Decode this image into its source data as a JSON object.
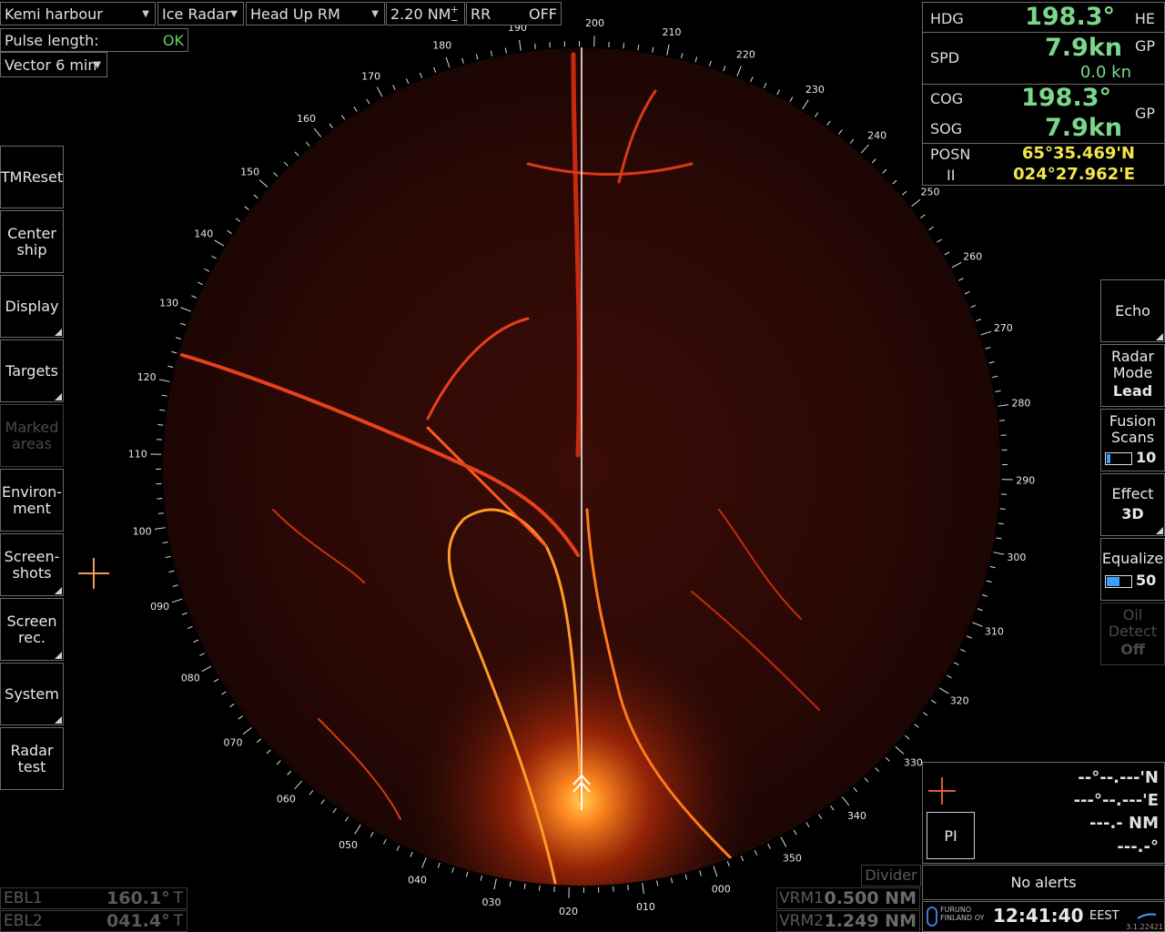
{
  "topbar": {
    "area": "Kemi harbour",
    "radar": "Ice Radar",
    "orientation": "Head Up RM",
    "range": "2.20 NM",
    "rr_label": "RR",
    "rr_value": "OFF"
  },
  "pulse": {
    "label": "Pulse length:",
    "value": "OK"
  },
  "vector": "Vector 6 min",
  "left_menu": [
    "TMReset",
    "Center\nship",
    "Display",
    "Targets",
    "Marked\nareas",
    "Environ-\nment",
    "Screen-\nshots",
    "Screen\nrec.",
    "System",
    "Radar\ntest"
  ],
  "nav": {
    "hdg_label": "HDG",
    "hdg_value": "198.3°",
    "hdg_src": "HE",
    "spd_label": "SPD",
    "spd_value": "7.9kn",
    "spd_src": "GP",
    "spd_sub": "0.0 kn",
    "cog_label": "COG",
    "cog_value": "198.3°",
    "sog_label": "SOG",
    "sog_value": "7.9kn",
    "cog_src": "GP",
    "posn_label": "POSN",
    "posn_src": "II",
    "lat": "65°35.469'N",
    "lon": "024°27.962'E"
  },
  "right_menu": {
    "echo": "Echo",
    "radar_mode_label": "Radar\nMode",
    "radar_mode_value": "Lead",
    "fusion_label": "Fusion\nScans",
    "fusion_value": "10",
    "effect_label": "Effect",
    "effect_value": "3D",
    "equalize_label": "Equalize",
    "equalize_value": "50",
    "oil_label": "Oil\nDetect",
    "oil_value": "Off"
  },
  "bearings": [
    "000",
    "010",
    "020",
    "030",
    "040",
    "050",
    "060",
    "070",
    "080",
    "090",
    "100",
    "110",
    "120",
    "130",
    "140",
    "150",
    "160",
    "170",
    "180",
    "190",
    "200",
    "210",
    "220",
    "230",
    "240",
    "250",
    "260",
    "270",
    "280",
    "290",
    "300",
    "310",
    "320",
    "330",
    "340",
    "350"
  ],
  "cursor_panel": {
    "pi_label": "PI",
    "lat": "--°--.---'N",
    "lon": "---°--.---'E",
    "range": "---.- NM",
    "bearing": "---.-°"
  },
  "divider": "Divider",
  "alerts": "No alerts",
  "ebl": [
    {
      "label": "EBL1",
      "value": "160.1°",
      "unit": "T"
    },
    {
      "label": "EBL2",
      "value": "041.4°",
      "unit": "T"
    }
  ],
  "vrm": [
    {
      "label": "VRM1",
      "value": "0.500 NM"
    },
    {
      "label": "VRM2",
      "value": "1.249 NM"
    }
  ],
  "footer": {
    "logo_line1": "FURUNO",
    "logo_line2": "FINLAND OY",
    "time": "12:41:40",
    "tz": "EEST",
    "version": "3.1.22421"
  },
  "colors": {
    "accent_green": "#7bd88a",
    "posn_yellow": "#f3e64a",
    "echo_red": "#e03018",
    "cursor_orange": "#f0a050"
  }
}
